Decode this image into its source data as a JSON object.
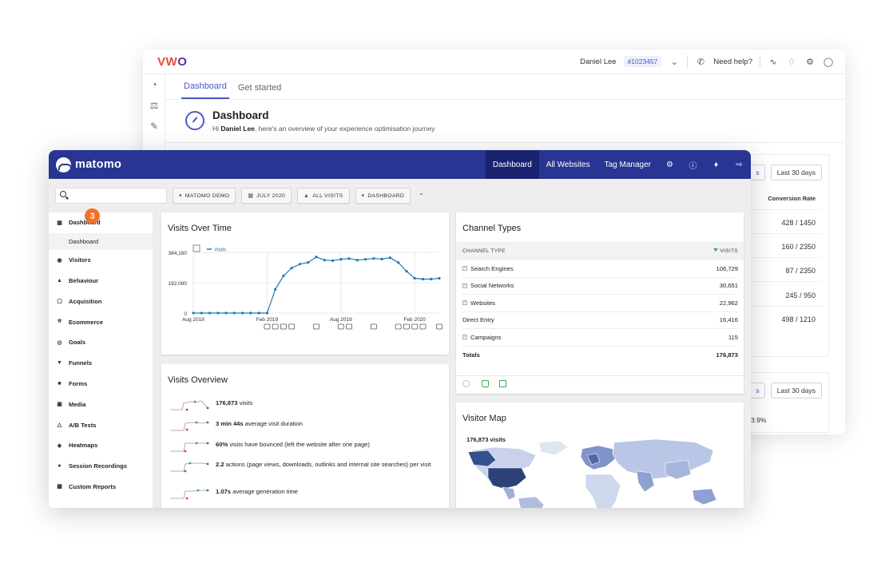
{
  "vwo": {
    "logo": "VWO",
    "user_name": "Daniel Lee",
    "account_id": "#1023457",
    "help_label": "Need help?",
    "tabs": [
      "Dashboard",
      "Get started"
    ],
    "heading": "Dashboard",
    "subtitle_prefix": "Hi ",
    "subtitle_name": "Daniel Lee",
    "subtitle_suffix": ", here's an overview of your experience optimisation journey",
    "card1": {
      "range_partial": "s",
      "range_button": "Last 30 days",
      "column": "Conversion Rate",
      "rows": [
        "428 / 1450",
        "160 / 2350",
        "87 / 2350",
        "245 / 950",
        "498 / 1210"
      ]
    },
    "card2": {
      "range_partial": "s",
      "range_button": "Last 30 days",
      "value_partial": "3.9%"
    }
  },
  "matomo": {
    "logo": "matomo",
    "nav": [
      "Dashboard",
      "All Websites",
      "Tag Manager"
    ],
    "selectors": [
      "MATOMO DEMO",
      "JULY 2020",
      "ALL VISITS",
      "DASHBOARD"
    ],
    "badge": "3",
    "menu": [
      {
        "label": "Dashboard",
        "icon": "grid-icon"
      },
      {
        "label": "Dashboard",
        "sub": true
      },
      {
        "label": "Visitors",
        "icon": "visitors-icon"
      },
      {
        "label": "Behaviour",
        "icon": "bell-icon"
      },
      {
        "label": "Acquisition",
        "icon": "acquisition-icon"
      },
      {
        "label": "Ecommerce",
        "icon": "cart-icon"
      },
      {
        "label": "Goals",
        "icon": "target-icon"
      },
      {
        "label": "Funnels",
        "icon": "funnel-icon"
      },
      {
        "label": "Forms",
        "icon": "form-icon"
      },
      {
        "label": "Media",
        "icon": "media-icon"
      },
      {
        "label": "A/B Tests",
        "icon": "flask-icon"
      },
      {
        "label": "Heatmaps",
        "icon": "flame-icon"
      },
      {
        "label": "Session Recordings",
        "icon": "record-icon"
      },
      {
        "label": "Custom Reports",
        "icon": "report-icon"
      }
    ],
    "visits_over_time": {
      "title": "Visits Over Time",
      "legend": "Visits",
      "y_ticks": [
        "384,160",
        "192,080",
        "0"
      ],
      "x_ticks": [
        "Aug 2018",
        "Feb 2019",
        "Aug 2019",
        "Feb 2020"
      ]
    },
    "visits_overview": {
      "title": "Visits Overview",
      "rows": [
        {
          "bold": "176,873",
          "text": " visits"
        },
        {
          "bold": "3 min 44s",
          "text": " average visit duration"
        },
        {
          "bold": "60%",
          "text": " visits have bounced (left the website after one page)"
        },
        {
          "bold": "2.2",
          "text": " actions (page views, downloads, outlinks and internal site searches) per visit"
        },
        {
          "bold": "1.07s",
          "text": " average generation time"
        }
      ]
    },
    "channel_types": {
      "title": "Channel Types",
      "col_left": "CHANNEL TYPE",
      "col_right": "VISITS",
      "rows": [
        {
          "label": "Search Engines",
          "value": "106,729",
          "expandable": true
        },
        {
          "label": "Social Networks",
          "value": "30,651",
          "expandable": true
        },
        {
          "label": "Websites",
          "value": "22,962",
          "expandable": true
        },
        {
          "label": "Direct Entry",
          "value": "16,416",
          "expandable": false
        },
        {
          "label": "Campaigns",
          "value": "115",
          "expandable": true
        }
      ],
      "total_label": "Totals",
      "total_value": "176,873"
    },
    "visitor_map": {
      "title": "Visitor Map",
      "summary": "176,873 visits"
    }
  },
  "chart_data": {
    "type": "line",
    "title": "Visits Over Time",
    "series": [
      {
        "name": "Visits",
        "values": [
          0,
          0,
          0,
          0,
          0,
          0,
          0,
          0,
          0,
          0,
          150000,
          235000,
          285000,
          310000,
          320000,
          355000,
          335000,
          332000,
          340000,
          345000,
          335000,
          340000,
          345000,
          342000,
          350000,
          320000,
          265000,
          220000,
          215000,
          215000,
          220000
        ]
      }
    ],
    "x_tick_labels": [
      "Aug 2018",
      "Feb 2019",
      "Aug 2019",
      "Feb 2020"
    ],
    "x_tick_index": [
      0,
      9,
      18,
      27
    ],
    "ylim": [
      0,
      384160
    ],
    "y_ticks": [
      0,
      192080,
      384160
    ],
    "annotation_index": [
      9,
      10,
      11,
      12,
      15,
      18,
      19,
      22,
      25,
      26,
      27,
      28,
      31
    ],
    "color": "#1f78b4"
  }
}
